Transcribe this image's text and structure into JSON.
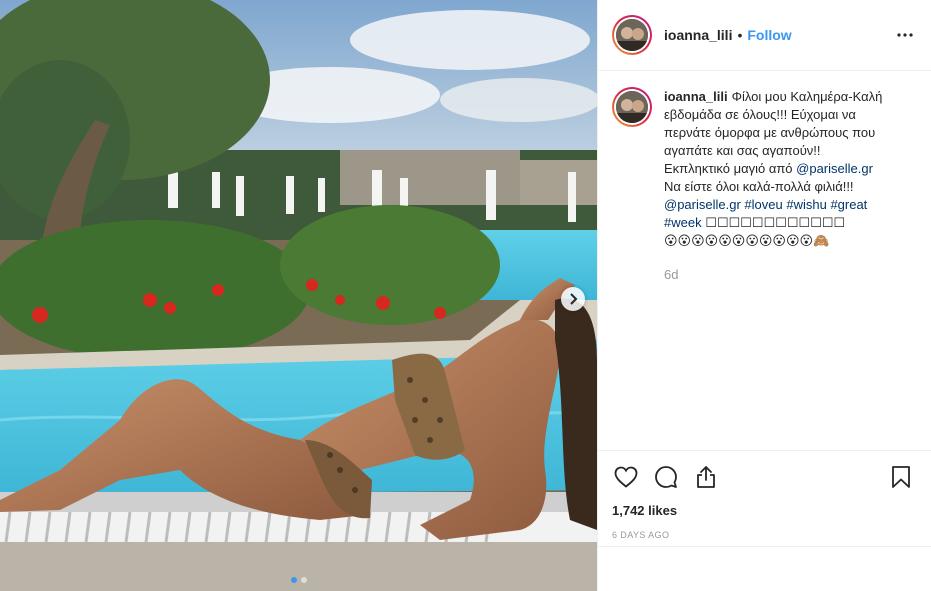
{
  "post": {
    "username": "ioanna_lili",
    "separator": "•",
    "follow_label": "Follow",
    "more_icon": "more-horizontal-icon",
    "caption": {
      "username": "ioanna_lili",
      "line1": "Φίλοι μου Καλημέρα-Καλή",
      "line2": "εβδομάδα σε όλους!!! Εύχομαι να",
      "line3": "περνάτε όμορφα με ανθρώπους που",
      "line4": "αγαπάτε και σας αγαπούν!!",
      "line5_prefix": "Εκπληκτικό μαγιό από ",
      "line5_mention": "@pariselle.gr",
      "line6": "Να είστε όλοι καλά-πολλά φιλιά!!!",
      "line7_mention": "@pariselle.gr",
      "line7_tag1": "#loveu",
      "line7_tag2": "#wishu",
      "line7_tag3": "#great",
      "line8_tag": "#week",
      "line8_rest": " ☐☐☐☐☐☐☐☐☐☐☐☐",
      "line9": "😮😮😮😮😮😮😮😮😮😮😮🙈"
    },
    "caption_time": "6d",
    "likes": "1,742 likes",
    "time_ago": "6 DAYS AGO",
    "carousel": {
      "count": 2,
      "active": 1,
      "next_icon": "chevron-right-icon"
    },
    "icons": {
      "like": "heart-icon",
      "comment": "comment-icon",
      "share": "share-icon",
      "save": "bookmark-icon"
    },
    "colors": {
      "accent": "#3897f0",
      "text": "#262626",
      "muted": "#999999",
      "link": "#003569",
      "border": "#efefef"
    }
  }
}
